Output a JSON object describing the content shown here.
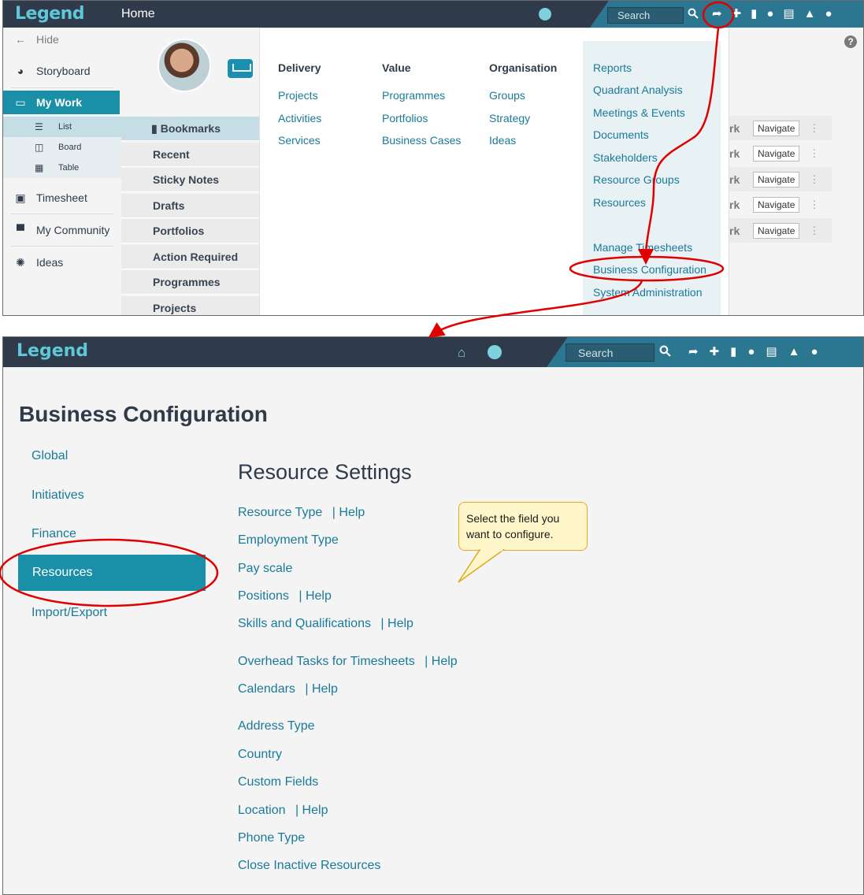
{
  "top": {
    "logo": "Legend",
    "title": "Home",
    "search_placeholder": "Search",
    "hide": "Hide",
    "sidebar": {
      "storyboard": "Storyboard",
      "my_work": "My Work",
      "list": "List",
      "board": "Board",
      "table": "Table",
      "timesheet": "Timesheet",
      "my_community": "My Community",
      "ideas": "Ideas"
    },
    "mid": [
      "Bookmarks",
      "Recent",
      "Sticky Notes",
      "Drafts",
      "Portfolios",
      "Action Required",
      "Programmes",
      "Projects"
    ],
    "mega": {
      "delivery": {
        "heading": "Delivery",
        "items": [
          "Projects",
          "Activities",
          "Services"
        ]
      },
      "value": {
        "heading": "Value",
        "items": [
          "Programmes",
          "Portfolios",
          "Business Cases"
        ]
      },
      "organisation": {
        "heading": "Organisation",
        "items": [
          "Groups",
          "Strategy",
          "Ideas"
        ]
      },
      "right": [
        "Reports",
        "Quadrant Analysis",
        "Meetings & Events",
        "Documents",
        "Stakeholders",
        "Resource Groups",
        "Resources",
        "Manage Timesheets",
        "Business Configuration",
        "System Administration"
      ]
    },
    "rows": {
      "rk": "rk",
      "navigate": "Navigate"
    }
  },
  "bottom": {
    "logo": "Legend",
    "search_placeholder": "Search",
    "page_title": "Business Configuration",
    "nav": [
      "Global",
      "Initiatives",
      "Finance",
      "Resources",
      "Import/Export"
    ],
    "section_title": "Resource Settings",
    "links": {
      "resource_type": "Resource Type",
      "employment_type": "Employment Type",
      "pay_scale": "Pay scale",
      "positions": "Positions",
      "skills": "Skills and Qualifications",
      "overhead": "Overhead Tasks for Timesheets",
      "calendars": "Calendars",
      "address_type": "Address Type",
      "country": "Country",
      "custom_fields": "Custom Fields",
      "location": "Location",
      "phone_type": "Phone Type",
      "close_inactive": "Close Inactive Resources",
      "help": "| Help"
    },
    "tooltip": "Select the field you want to configure."
  },
  "colors": {
    "accent": "#1a8fa8",
    "topbar": "#2f3b4a",
    "link": "#1a7a9a",
    "annotation": "#e00000"
  }
}
